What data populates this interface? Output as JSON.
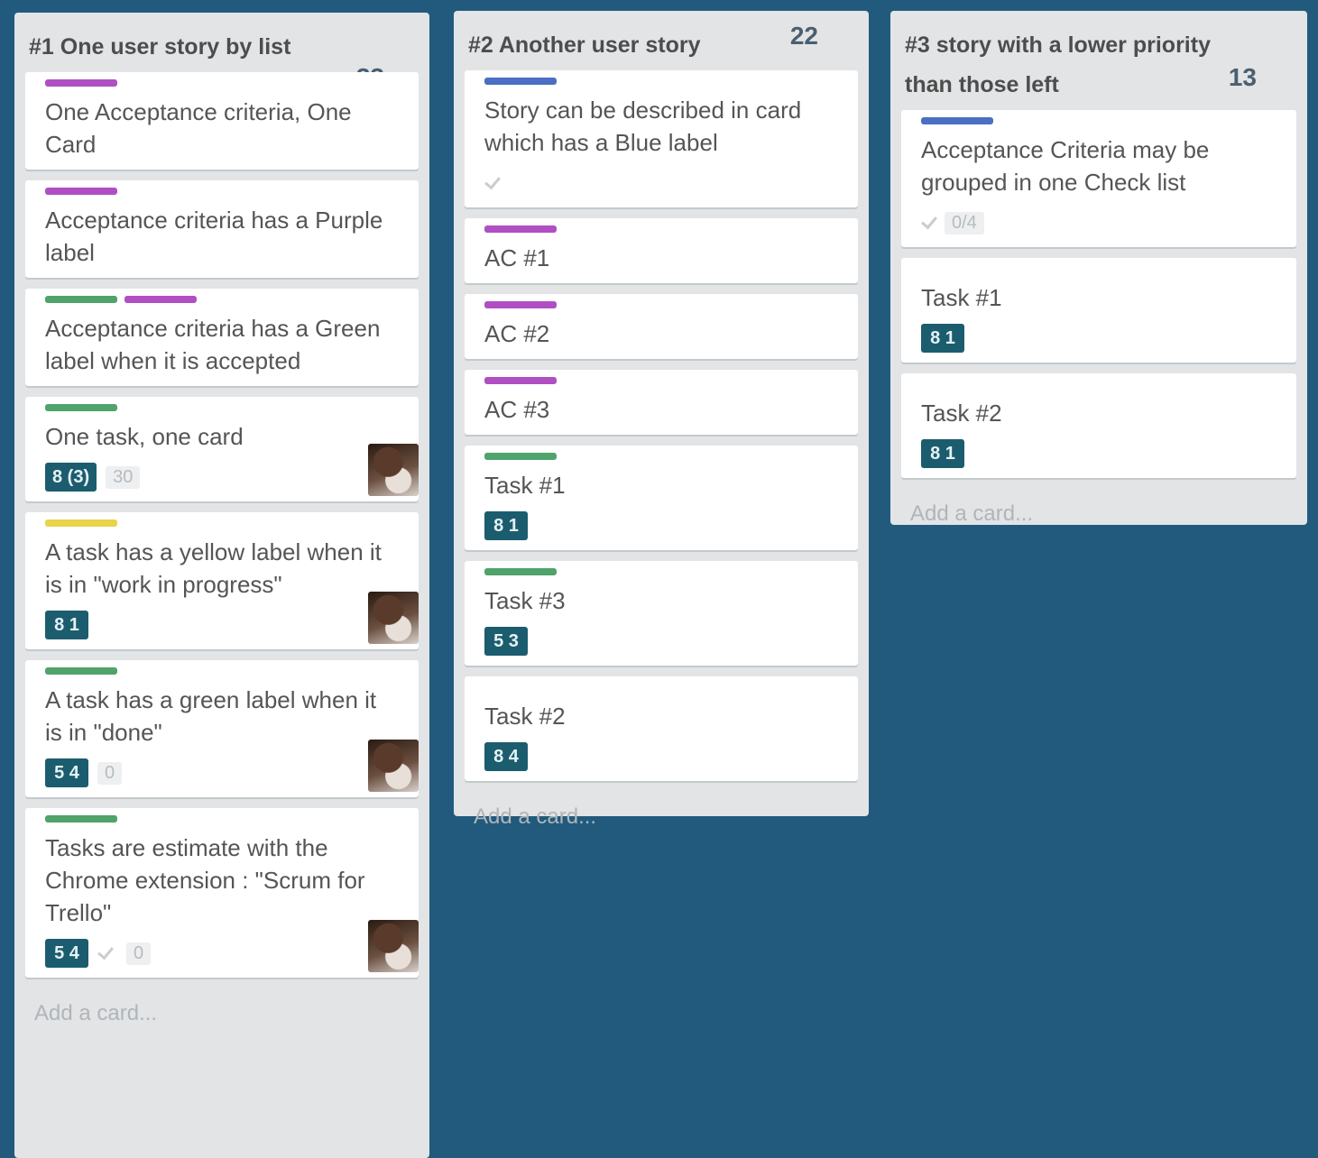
{
  "colors": {
    "board_bg": "#215a7d",
    "list_bg": "#e2e4e6",
    "label_purple": "#b04fc3",
    "label_green": "#4fa36b",
    "label_yellow": "#e8d34a",
    "label_blue": "#4a6fc3",
    "estimate_badge": "#1b5d6e"
  },
  "lists": [
    {
      "title": "#1 One user story by list",
      "points": "33",
      "cards": [
        {
          "labels": [
            "label_purple"
          ],
          "title": "One Acceptance criteria, One Card"
        },
        {
          "labels": [
            "label_purple"
          ],
          "title": "Acceptance criteria has a Purple label"
        },
        {
          "labels": [
            "label_green",
            "label_purple"
          ],
          "title": "Acceptance criteria has a Green label when it is accepted"
        },
        {
          "labels": [
            "label_green"
          ],
          "title": "One task, one card",
          "estimate": "8 (3)",
          "comments": "30",
          "avatar": true
        },
        {
          "labels": [
            "label_yellow"
          ],
          "title": "A task has a yellow label when it is in \"work in progress\"",
          "estimate": "8 1",
          "avatar": true
        },
        {
          "labels": [
            "label_green"
          ],
          "title": "A task has a green label when it is in \"done\"",
          "estimate": "5 4",
          "comments": "0",
          "avatar": true
        },
        {
          "labels": [
            "label_green"
          ],
          "title": "Tasks are estimate with the Chrome extension : \"Scrum for Trello\"",
          "estimate": "5 4",
          "checklist": true,
          "comments": "0",
          "avatar": true
        }
      ],
      "add_card": "Add a card..."
    },
    {
      "title": "#2 Another user story",
      "points": "22",
      "cards": [
        {
          "labels": [
            "label_blue"
          ],
          "title": "Story can be described in card which has a Blue label",
          "checklist": true
        },
        {
          "labels": [
            "label_purple"
          ],
          "title": "AC #1"
        },
        {
          "labels": [
            "label_purple"
          ],
          "title": "AC #2"
        },
        {
          "labels": [
            "label_purple"
          ],
          "title": "AC #3"
        },
        {
          "labels": [
            "label_green"
          ],
          "title": "Task #1",
          "estimate": "8 1"
        },
        {
          "labels": [
            "label_green"
          ],
          "title": "Task #3",
          "estimate": "5 3"
        },
        {
          "labels": [],
          "title": "Task #2",
          "estimate": "8 4"
        }
      ],
      "add_card": "Add a card..."
    },
    {
      "title": "#3 story with a lower priority than those left",
      "points": "13",
      "cards": [
        {
          "labels": [
            "label_blue"
          ],
          "title": "Acceptance Criteria may be grouped in one Check list",
          "checklist": true,
          "checklist_count": "0/4"
        },
        {
          "labels": [],
          "title": "Task #1",
          "estimate": "8 1"
        },
        {
          "labels": [],
          "title": "Task #2",
          "estimate": "8 1"
        }
      ],
      "add_card": "Add a card..."
    }
  ]
}
